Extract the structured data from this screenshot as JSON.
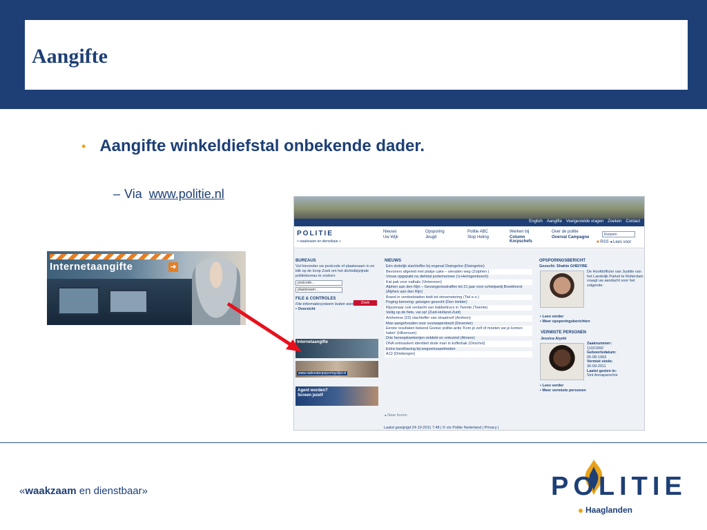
{
  "slide": {
    "title": "Aangifte",
    "bullet": "Aangifte winkeldiefstal onbekende dader.",
    "sub_prefix": "Via",
    "sub_link": "www.politie.nl"
  },
  "banner": {
    "label": "Internetaangifte",
    "arrow_icon": "arrow-right-icon"
  },
  "footer": {
    "slogan_left": "«",
    "slogan_bold": "waakzaam",
    "slogan_rest": " en dienstbaar",
    "slogan_right": "»",
    "logo_text": "POLITIE",
    "region": "Haaglanden"
  },
  "colors": {
    "brand_blue": "#1d3f76",
    "accent_orange": "#e8a31b",
    "arrow_red": "#e8101c"
  },
  "site": {
    "nav_links": [
      "English",
      "Aangifte",
      "Veelgestelde vragen",
      "Zoeken",
      "Contact"
    ],
    "logo": "POLITIE",
    "slogan": "« waakzaam en dienstbaar »",
    "menu": [
      [
        "Nieuws",
        "Uw Wijk"
      ],
      [
        "Opsporing",
        "Jeugd"
      ],
      [
        "Politie ABC",
        "Stop Heling"
      ],
      [
        "Werken bij",
        "Column Korpschefs"
      ],
      [
        "Over de politie",
        "Overval Campagne"
      ]
    ],
    "search_value": "Korpsen",
    "rss": "RSS",
    "lees_voor": "Lees voor",
    "bureaus_title": "BUREAUS",
    "bureaus_text": "Vul hieronder uw postcode of plaatsnaam in en klik op de knop Zoek om het dichtstbijzijnde politiebureau te zoeken:",
    "postcode_placeholder": "postcode...",
    "plaats_placeholder": "plaatsnaam...",
    "zoek_button": "Zoek",
    "file_title": "FILE & CONTROLES",
    "file_text": "File-informatiesysteem buiten werking",
    "file_link": "Overzicht",
    "mini_banner_1": "Internetaangifte",
    "mini_banner_2": "www.nationaleopsporingslijst.nl",
    "mini_banner_3": "Agent worden? Screen jezelf",
    "news_title": "NIEUWS",
    "news": [
      "Eén dodelijk slachtoffer bij ongeval Dwingeloo (Dwingeloo)",
      "Bevoners afgeleid met plakje cake – sieraden weg (Zutphen )",
      "Vrouw opgepakt na diefstal portemonnee ('s-Hertogenbosch)",
      "Kat pak voor nathals (Vinkeveen)",
      "Alphen aan den Rijn – Gevangenisstraffen tot 21 jaar voor schietpartij Broekhorst (Alphen aan den Rijn)",
      "Brand in verdeelstation leidt tot stroomstoring (Tiel e.o.)",
      "Poging beroving: getuigen gezocht (Den Helder)",
      "Rijzzenaar ook verdacht van babbeltrucs in Twente (Twente)",
      "Veilig op de fiets, val op! (Zuid-Holland-Zuid)",
      "Arnhemse (22) slachtoffer van straatroof (Arnhem)",
      "Man aangehouden voor vuurwapenbezit (Deventer)",
      "Eerste resultaten bekend Gooise politie-actie 'Kom je zelf of moeten we je komen halen' (Hilversum)",
      "Drie hennepkwekerijen ontdekt en ontruimd (Almere)",
      "DNA ontmaskert identiteit dode man in kofferbak (Oirschot)",
      "Extra handhaving bij wegverkzaamheden",
      "A12 (Driebergen)"
    ],
    "naar_boven": "Naar boven",
    "footer": "Laatst gewijzigd 24-10-2011 7:48 | © vtz Politie Nederland | Privacy |",
    "opsporing_title": "OPSPORINGSBERICHT",
    "opsporing_name": "Gezocht: Shahin GHEIYBE",
    "opsporing_text": "De Hoofdofficier van Justitie van het Landelijk Parket te Rotterdam vraagt uw aandacht voor het volgende:",
    "lees_verder": "Lees verder",
    "meer_opsporing": "Meer opsporingsberichten",
    "vermiste_title": "VERMISTE PERSONEN",
    "vermiste_name": "Jessica Aiyeki",
    "vermiste_details": [
      "Zaaknummer:",
      "11021892",
      "Geboortedatum:",
      "05-08-1993",
      "Vermist sinds:",
      "30-09-2011",
      "Laatst gezien in:",
      "Sint Annaparochie"
    ],
    "lees_verder_2": "Lees verder",
    "meer_vermiste": "Meer vermiste personen"
  }
}
